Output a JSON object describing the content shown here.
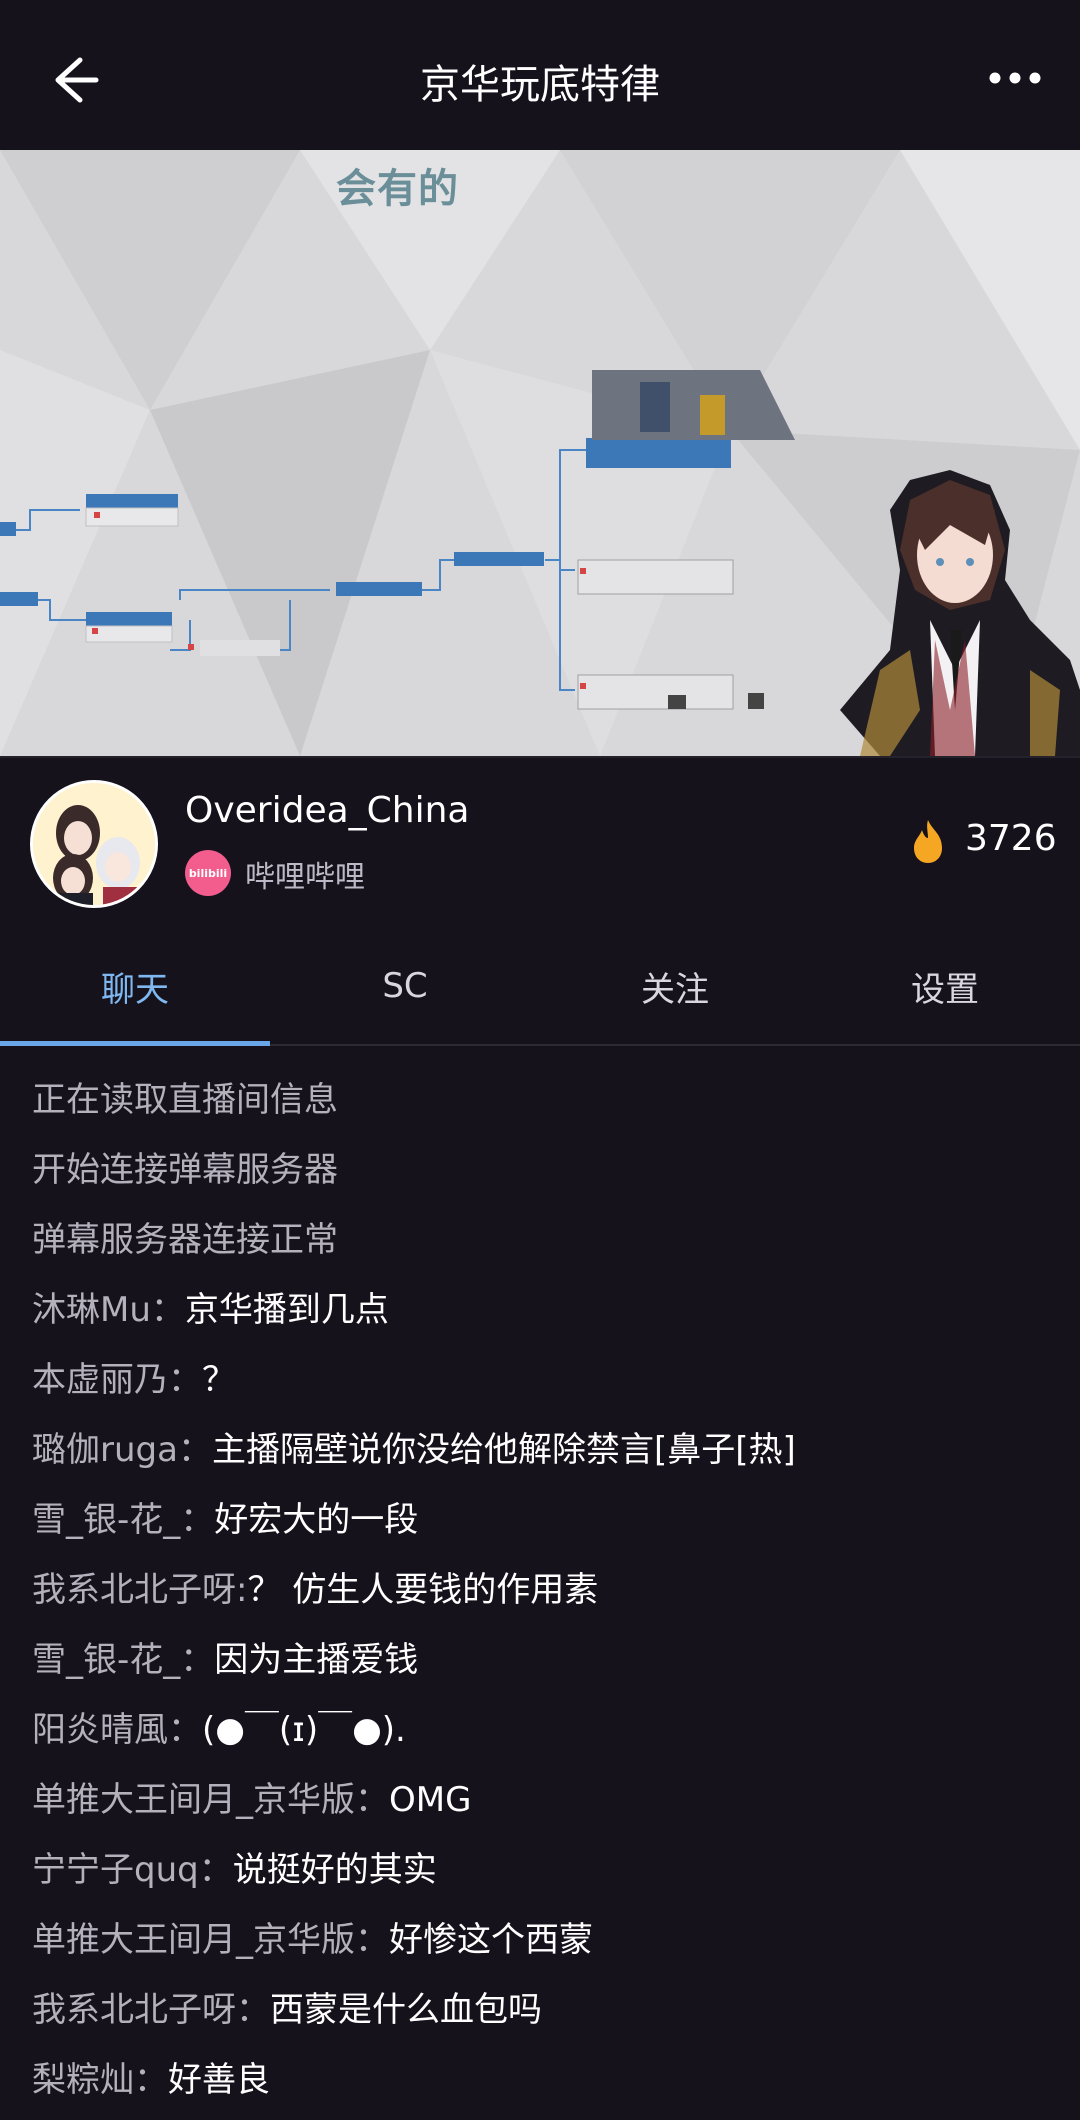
{
  "header": {
    "title": "京华玩底特律"
  },
  "video": {
    "subtitle": "会有的"
  },
  "streamer": {
    "name": "Overidea_China",
    "platform": "哔哩哔哩",
    "platform_logo": "bilibili",
    "popularity": "3726"
  },
  "tabs": [
    {
      "label": "聊天",
      "active": true
    },
    {
      "label": "SC",
      "active": false
    },
    {
      "label": "关注",
      "active": false
    },
    {
      "label": "设置",
      "active": false
    }
  ],
  "chat": {
    "system": [
      "正在读取直播间信息",
      "开始连接弹幕服务器",
      "弹幕服务器连接正常"
    ],
    "messages": [
      {
        "user": "沐琳Mu：",
        "text": "京华播到几点"
      },
      {
        "user": "本虚丽乃：",
        "text": "？"
      },
      {
        "user": "璐伽ruga：",
        "text": "主播隔壁说你没给他解除禁言[鼻子[热]"
      },
      {
        "user": "雪_银-花_：",
        "text": "好宏大的一段"
      },
      {
        "user": "我系北北子呀:",
        "text": "？ 仿生人要钱的作用素"
      },
      {
        "user": "雪_银-花_：",
        "text": "因为主播爱钱"
      },
      {
        "user": "阳炎晴風：",
        "text": "(●￣(ɪ)￣●)."
      },
      {
        "user": "单推大王间月_京华版：",
        "text": "OMG"
      },
      {
        "user": "宁宁子quq：",
        "text": "说挺好的其实"
      },
      {
        "user": "单推大王间月_京华版：",
        "text": "好惨这个西蒙"
      },
      {
        "user": "我系北北子呀：",
        "text": "西蒙是什么血包吗"
      },
      {
        "user": "梨粽灿：",
        "text": "好善良"
      }
    ]
  },
  "colors": {
    "background": "#15121c",
    "accent": "#7fb8f0",
    "fire": "#f5a623",
    "bilibili_pink": "#f25d8e"
  }
}
